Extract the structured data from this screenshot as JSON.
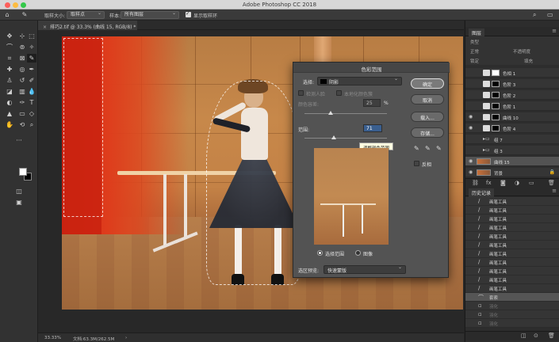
{
  "window": {
    "title": "Adobe Photoshop CC 2018"
  },
  "options_bar": {
    "sample_size_label": "取样大小:",
    "sample_size_value": "取样点",
    "sample_label": "样本:",
    "sample_value": "所有图层",
    "show_ring_label": "显示取样环"
  },
  "document_tab": {
    "label": "排巧2.tif @ 33.3% (曲线 15, RGB/8) *"
  },
  "status": {
    "zoom": "33.33%",
    "doc_size": "文档:63.3M/262.5M"
  },
  "dialog": {
    "title": "色彩范围",
    "select_label": "选择:",
    "select_value": "阴影",
    "detect_faces_label": "检测人脸",
    "localized_label": "本地化颜色簇",
    "fuzziness_label": "颜色容差:",
    "fuzziness_value": "25",
    "fuzziness_unit": "%",
    "range_label": "范围:",
    "range_value": "71",
    "tooltip": "调整颜色范围",
    "radio_selection": "选择范围",
    "radio_image": "图像",
    "preview_label": "选区预览:",
    "preview_value": "快速蒙版",
    "ok_button": "确定",
    "cancel_button": "取消",
    "load_button": "载入...",
    "save_button": "存储...",
    "invert_label": "反相"
  },
  "layers_panel": {
    "tab": "图层",
    "kind_label": "类型",
    "blend_mode": "正常",
    "opacity_label": "不透明度",
    "lock_label": "锁定",
    "fill_label": "填充",
    "layers": [
      {
        "name": "色相 1",
        "type": "adjust-white"
      },
      {
        "name": "色阶 3",
        "type": "adjust"
      },
      {
        "name": "色阶 2",
        "type": "adjust"
      },
      {
        "name": "色阶 1",
        "type": "adjust"
      },
      {
        "name": "曲线 10",
        "type": "adjust"
      },
      {
        "name": "色阶 4",
        "type": "adjust"
      },
      {
        "name": "组 7",
        "type": "group"
      },
      {
        "name": "组 3",
        "type": "group"
      },
      {
        "name": "曲线 15",
        "type": "selected"
      },
      {
        "name": "背景",
        "type": "background"
      }
    ]
  },
  "history_panel": {
    "tab": "历史记录",
    "items": [
      {
        "name": "画笔工具",
        "state": "normal"
      },
      {
        "name": "画笔工具",
        "state": "normal"
      },
      {
        "name": "画笔工具",
        "state": "normal"
      },
      {
        "name": "画笔工具",
        "state": "normal"
      },
      {
        "name": "画笔工具",
        "state": "normal"
      },
      {
        "name": "画笔工具",
        "state": "normal"
      },
      {
        "name": "画笔工具",
        "state": "normal"
      },
      {
        "name": "画笔工具",
        "state": "normal"
      },
      {
        "name": "画笔工具",
        "state": "normal"
      },
      {
        "name": "画笔工具",
        "state": "normal"
      },
      {
        "name": "画笔工具",
        "state": "normal"
      },
      {
        "name": "套索",
        "state": "selected"
      },
      {
        "name": "羽化",
        "state": "dim"
      },
      {
        "name": "羽化",
        "state": "dim"
      },
      {
        "name": "羽化",
        "state": "dim"
      }
    ]
  }
}
